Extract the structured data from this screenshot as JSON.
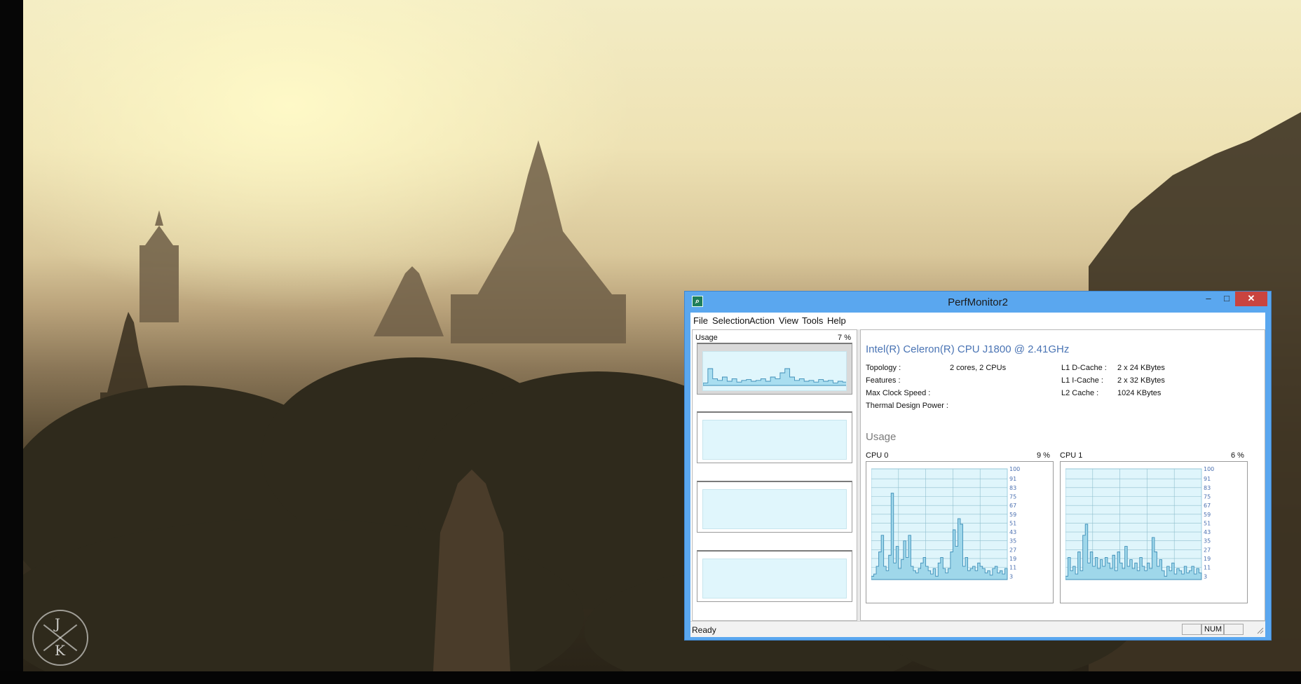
{
  "window": {
    "title": "PerfMonitor2",
    "icon": "magnifier-icon",
    "controls": {
      "minimize": "–",
      "maximize": "□",
      "close": "✕"
    }
  },
  "menu": [
    "File",
    "Selection",
    "Action",
    "View",
    "Tools",
    "Help"
  ],
  "left_pane": {
    "usage_label": "Usage",
    "usage_value": "7 %",
    "thumbnails": 4
  },
  "cpu": {
    "name": "Intel(R) Celeron(R) CPU  J1800  @ 2.41GHz",
    "left_info": [
      {
        "label": "Topology :",
        "value": "2 cores, 2 CPUs"
      },
      {
        "label": "Features :",
        "value": ""
      },
      {
        "label": "Max Clock Speed :",
        "value": ""
      },
      {
        "label": "Thermal Design Power :",
        "value": ""
      }
    ],
    "right_info": [
      {
        "label": "L1 D-Cache :",
        "value": "2 x 24 KBytes"
      },
      {
        "label": "L1 I-Cache :",
        "value": "2 x 32 KBytes"
      },
      {
        "label": "L2 Cache :",
        "value": "1024 KBytes"
      }
    ]
  },
  "usage_section_title": "Usage",
  "chart_data": [
    {
      "type": "area",
      "title": "CPU 0",
      "current_value": "9 %",
      "y_ticks": [
        100,
        91,
        83,
        75,
        67,
        59,
        51,
        43,
        35,
        27,
        19,
        11,
        3
      ],
      "ylim": [
        0,
        100
      ],
      "values": [
        3,
        5,
        12,
        25,
        40,
        12,
        8,
        22,
        78,
        15,
        30,
        10,
        18,
        35,
        20,
        40,
        12,
        8,
        6,
        10,
        15,
        20,
        12,
        8,
        5,
        10,
        3,
        15,
        20,
        10,
        6,
        10,
        25,
        45,
        30,
        55,
        50,
        12,
        20,
        8,
        10,
        12,
        8,
        15,
        12,
        10,
        6,
        8,
        4,
        10,
        12,
        6,
        8,
        5,
        10
      ]
    },
    {
      "type": "area",
      "title": "CPU 1",
      "current_value": "6 %",
      "y_ticks": [
        100,
        91,
        83,
        75,
        67,
        59,
        51,
        43,
        35,
        27,
        19,
        11,
        3
      ],
      "ylim": [
        0,
        100
      ],
      "values": [
        3,
        20,
        8,
        12,
        5,
        25,
        8,
        40,
        50,
        15,
        25,
        12,
        20,
        10,
        18,
        12,
        20,
        15,
        10,
        22,
        8,
        25,
        15,
        10,
        30,
        12,
        18,
        10,
        15,
        8,
        20,
        12,
        8,
        15,
        10,
        38,
        25,
        12,
        18,
        8,
        3,
        12,
        8,
        15,
        5,
        10,
        8,
        5,
        12,
        6,
        8,
        12,
        5,
        10,
        6
      ]
    }
  ],
  "left_thumb_series": [
    3,
    20,
    8,
    6,
    10,
    5,
    8,
    4,
    6,
    7,
    5,
    6,
    8,
    5,
    10,
    8,
    15,
    20,
    10,
    6,
    8,
    5,
    6,
    4,
    7,
    5,
    6,
    3,
    5,
    4
  ],
  "statusbar": {
    "text": "Ready",
    "num": "NUM"
  }
}
